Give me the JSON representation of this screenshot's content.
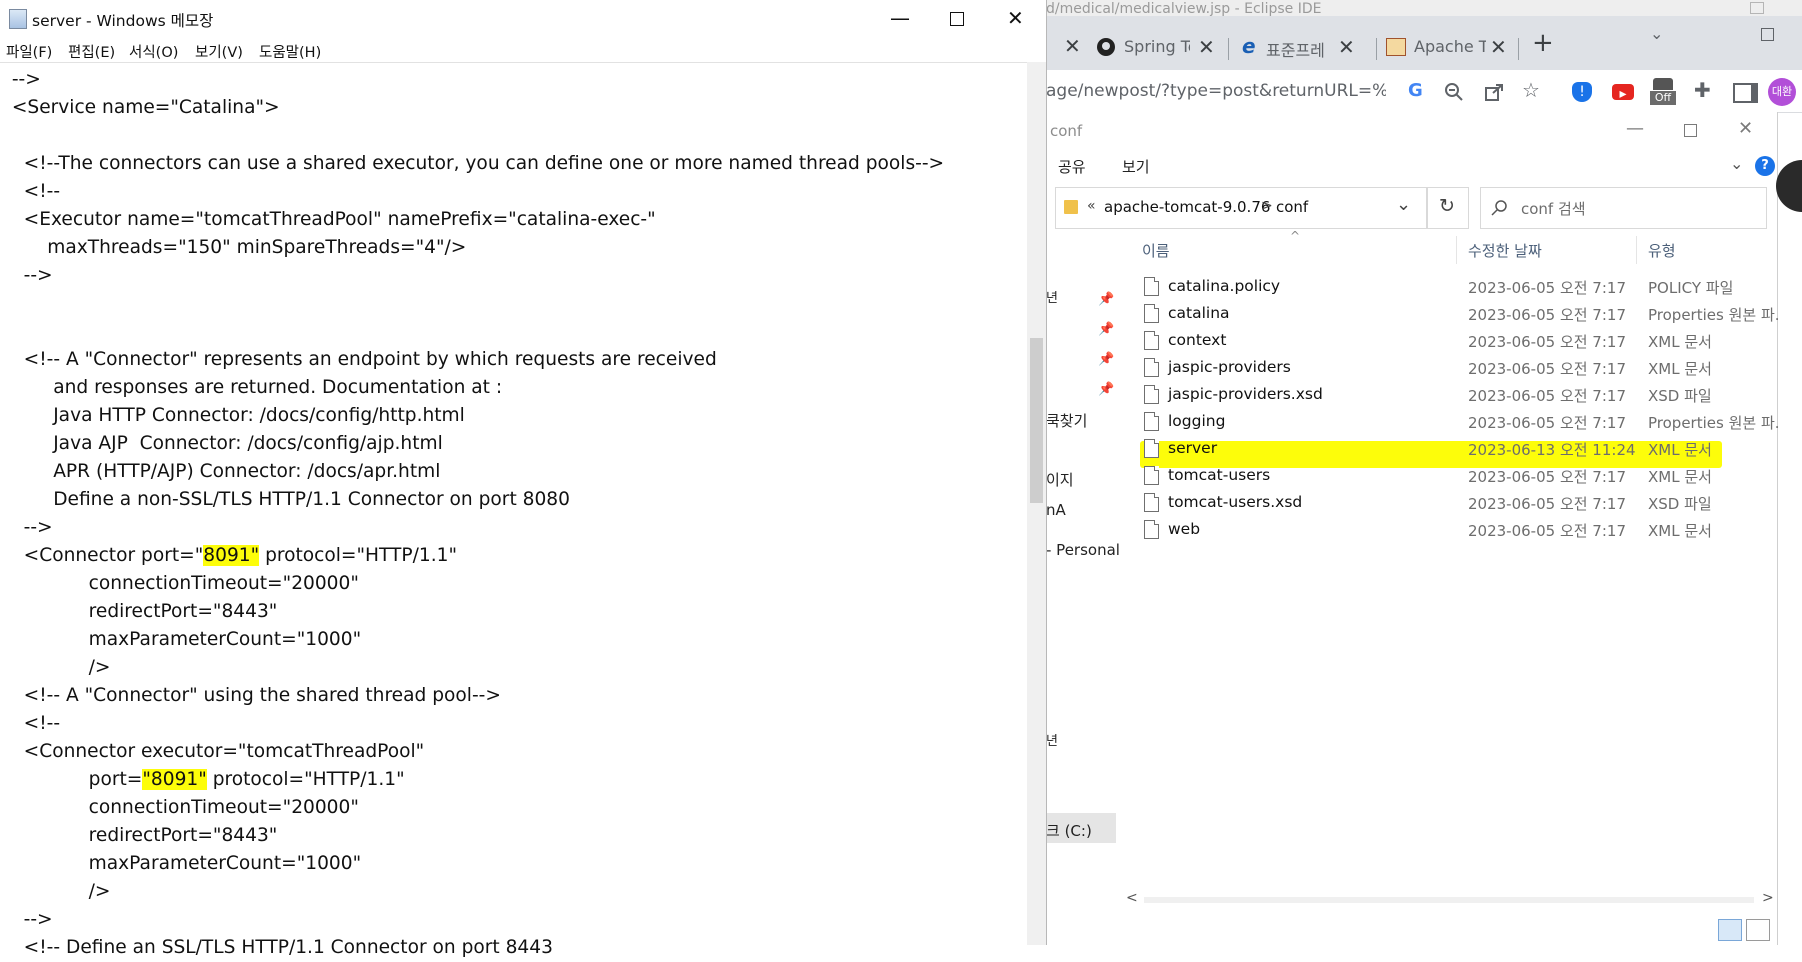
{
  "eclipse": {
    "title": "d/medical/medicalview.jsp - Eclipse IDE"
  },
  "browser": {
    "tabs": [
      {
        "label": "Spring Te"
      },
      {
        "label": "표준프레"
      },
      {
        "label": "Apache T"
      }
    ],
    "new_tab": "+",
    "url": "age/newpost/?type=post&returnURL=%2...",
    "profile": "대환",
    "ext_off_badge": "Off"
  },
  "explorer": {
    "title": "conf",
    "ribbon": {
      "share": "공유",
      "view": "보기"
    },
    "breadcrumb": {
      "prefix": "«",
      "parent": "apache-tomcat-9.0.76",
      "separator": ">",
      "current": "conf"
    },
    "search_placeholder": "conf 검색",
    "nav": [
      "쿡찾기",
      "이지",
      "nA",
      "- Personal",
      "크 (C:)"
    ],
    "columns": {
      "name": "이름",
      "modified": "수정한 날짜",
      "type": "유형"
    },
    "files": [
      {
        "name": "catalina.policy",
        "modified": "2023-06-05 오전 7:17",
        "type": "POLICY 파일"
      },
      {
        "name": "catalina",
        "modified": "2023-06-05 오전 7:17",
        "type": "Properties 원본 파..."
      },
      {
        "name": "context",
        "modified": "2023-06-05 오전 7:17",
        "type": "XML 문서"
      },
      {
        "name": "jaspic-providers",
        "modified": "2023-06-05 오전 7:17",
        "type": "XML 문서"
      },
      {
        "name": "jaspic-providers.xsd",
        "modified": "2023-06-05 오전 7:17",
        "type": "XSD 파일"
      },
      {
        "name": "logging",
        "modified": "2023-06-05 오전 7:17",
        "type": "Properties 원본 파..."
      },
      {
        "name": "server",
        "modified": "2023-06-13 오전 11:24",
        "type": "XML 문서"
      },
      {
        "name": "tomcat-users",
        "modified": "2023-06-05 오전 7:17",
        "type": "XML 문서"
      },
      {
        "name": "tomcat-users.xsd",
        "modified": "2023-06-05 오전 7:17",
        "type": "XSD 파일"
      },
      {
        "name": "web",
        "modified": "2023-06-05 오전 7:17",
        "type": "XML 문서"
      }
    ]
  },
  "notepad": {
    "title": "server - Windows 메모장",
    "menu": [
      "파일(F)",
      "편집(E)",
      "서식(O)",
      "보기(V)",
      "도움말(H)"
    ],
    "lines": {
      "l0": "  -->",
      "l1": "  <Service name=\"Catalina\">",
      "l2": "",
      "l3": "    <!--The connectors can use a shared executor, you can define one or more named thread pools-->",
      "l4": "    <!--",
      "l5": "    <Executor name=\"tomcatThreadPool\" namePrefix=\"catalina-exec-\"",
      "l6": "        maxThreads=\"150\" minSpareThreads=\"4\"/>",
      "l7": "    -->",
      "l8": "",
      "l9": "",
      "l10": "    <!-- A \"Connector\" represents an endpoint by which requests are received",
      "l11": "         and responses are returned. Documentation at :",
      "l12": "         Java HTTP Connector: /docs/config/http.html",
      "l13": "         Java AJP  Connector: /docs/config/ajp.html",
      "l14": "         APR (HTTP/AJP) Connector: /docs/apr.html",
      "l15": "         Define a non-SSL/TLS HTTP/1.1 Connector on port 8080",
      "l16": "    -->",
      "l17a": "    <Connector port=\"",
      "l17b": "8091\"",
      "l17c": " protocol=\"HTTP/1.1\"",
      "l18": "               connectionTimeout=\"20000\"",
      "l19": "               redirectPort=\"8443\"",
      "l20": "               maxParameterCount=\"1000\"",
      "l21": "               />",
      "l22": "    <!-- A \"Connector\" using the shared thread pool-->",
      "l23": "    <!--",
      "l24": "    <Connector executor=\"tomcatThreadPool\"",
      "l25a": "               port=",
      "l25b": "\"8091\"",
      "l25c": " protocol=\"HTTP/1.1\"",
      "l26": "               connectionTimeout=\"20000\"",
      "l27": "               redirectPort=\"8443\"",
      "l28": "               maxParameterCount=\"1000\"",
      "l29": "               />",
      "l30": "    -->",
      "l31": "    <!-- Define an SSL/TLS HTTP/1.1 Connector on port 8443"
    }
  }
}
